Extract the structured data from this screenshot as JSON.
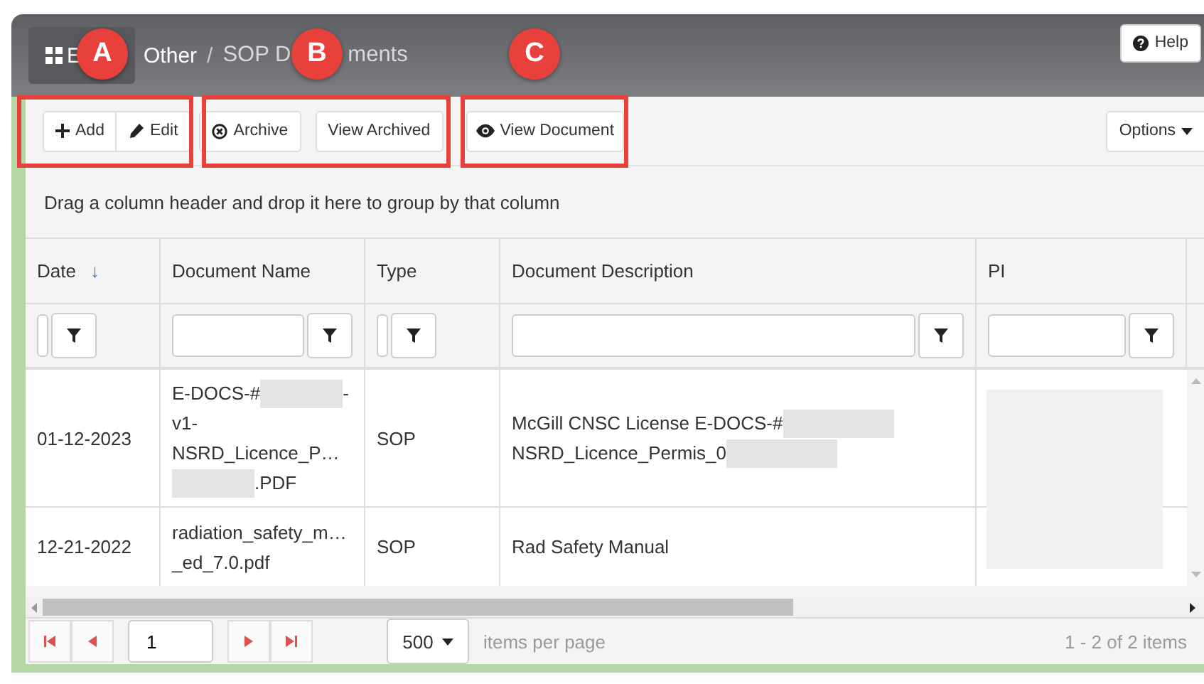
{
  "breadcrumb": {
    "home_label": "E",
    "items": [
      {
        "label": "Other"
      }
    ],
    "separator": "/",
    "current_parts": [
      "SOP D",
      "ments"
    ]
  },
  "help_button": "Help",
  "toolbar": {
    "buttons": [
      {
        "label": "Add"
      },
      {
        "label": "Edit"
      },
      {
        "label": "Archive"
      },
      {
        "label": "View Archived"
      },
      {
        "label": "View Document"
      }
    ],
    "options_button": "Options"
  },
  "callouts": [
    {
      "label": "A"
    },
    {
      "label": "B"
    },
    {
      "label": "C"
    }
  ],
  "group_hint": "Drag a column header and drop it here to group by that column",
  "table": {
    "columns": [
      {
        "label": "Date",
        "sort_indicator": "↓"
      },
      {
        "label": "Document Name"
      },
      {
        "label": "Type"
      },
      {
        "label": "Document Description"
      },
      {
        "label": "PI"
      }
    ],
    "pi_redacted": true,
    "rows": [
      {
        "date": "01-12-2023",
        "name": [
          [
            {
              "text": "E-DOCS-#"
            },
            {
              "kind": "redacted"
            },
            {
              "text": "-"
            }
          ],
          [
            {
              "text": "v1-"
            }
          ],
          [
            {
              "text": "NSRD_Licence_P…"
            }
          ],
          [
            {
              "kind": "redacted"
            },
            {
              "text": ".PDF"
            }
          ]
        ],
        "type": "SOP",
        "description": [
          [
            {
              "text": "McGill CNSC License E-DOCS-#"
            },
            {
              "kind": "redacted"
            }
          ],
          [
            {
              "text": "NSRD_Licence_Permis_0"
            },
            {
              "kind": "redacted"
            }
          ]
        ]
      },
      {
        "date": "12-21-2022",
        "name": [
          [
            {
              "text": "radiation_safety_m…"
            }
          ],
          [
            {
              "text": "_ed_7.0.pdf"
            }
          ]
        ],
        "type": "SOP",
        "description": [
          [
            {
              "text": "Rad Safety Manual"
            }
          ]
        ]
      }
    ]
  },
  "pager": {
    "page": "1",
    "page_size": "500",
    "page_size_label": "items per page",
    "summary": "1 - 2 of 2 items"
  }
}
